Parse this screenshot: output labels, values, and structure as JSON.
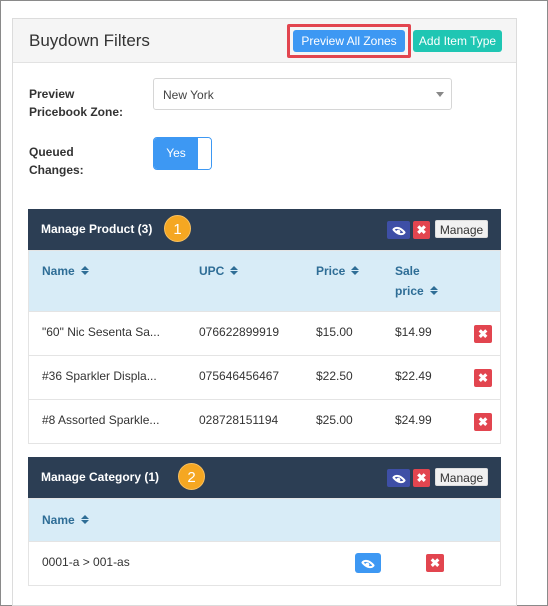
{
  "card": {
    "title": "Buydown Filters",
    "preview_all_zones": "Preview All Zones",
    "add_item_type": "Add Item Type"
  },
  "form": {
    "zone_label_line1": "Preview",
    "zone_label_line2": "Pricebook Zone:",
    "zone_value": "New York",
    "queued_label_line1": "Queued",
    "queued_label_line2": "Changes:",
    "queued_toggle": "Yes"
  },
  "product_panel": {
    "title": "Manage Product (3)",
    "badge": "1",
    "manage": "Manage",
    "columns": {
      "name": "Name",
      "upc": "UPC",
      "price": "Price",
      "sale_line1": "Sale",
      "sale_line2": "price"
    },
    "rows": [
      {
        "name": "\"60\" Nic Sesenta Sa...",
        "upc": "076622899919",
        "price": "$15.00",
        "sale": "$14.99"
      },
      {
        "name": "#36 Sparkler Displa...",
        "upc": "075646456467",
        "price": "$22.50",
        "sale": "$22.49"
      },
      {
        "name": "#8 Assorted Sparkle...",
        "upc": "028728151194",
        "price": "$25.00",
        "sale": "$24.99"
      }
    ]
  },
  "category_panel": {
    "title": "Manage Category (1)",
    "badge": "2",
    "manage": "Manage",
    "columns": {
      "name": "Name"
    },
    "rows": [
      {
        "name": "0001-a > 001-as"
      }
    ]
  },
  "icons": {
    "delete": "✖"
  }
}
